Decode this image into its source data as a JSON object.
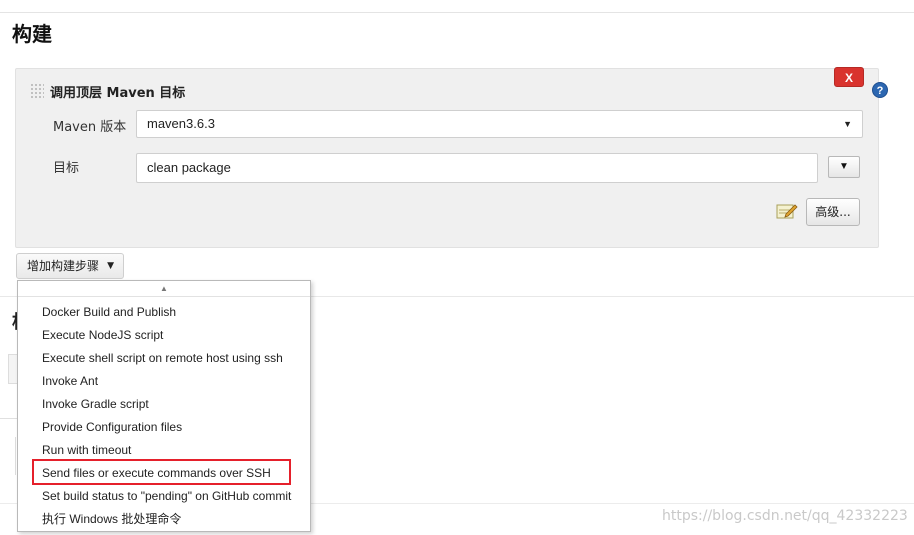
{
  "section": {
    "title": "构建"
  },
  "build_step": {
    "title": "调用顶层 Maven 目标",
    "delete_label": "X",
    "help_label": "?",
    "maven_version_label": "Maven 版本",
    "maven_version_value": "maven3.6.3",
    "goals_label": "目标",
    "goals_value": "clean package",
    "expand_label": "▼",
    "advanced_label": "高级..."
  },
  "add_step": {
    "label": "增加构建步骤",
    "caret": "▼"
  },
  "behind": {
    "title_fragment": "构"
  },
  "dropdown": {
    "scroll_up": "▲",
    "items": [
      {
        "label": "Docker Build and Publish"
      },
      {
        "label": "Execute NodeJS script"
      },
      {
        "label": "Execute shell script on remote host using ssh"
      },
      {
        "label": "Invoke Ant"
      },
      {
        "label": "Invoke Gradle script"
      },
      {
        "label": "Provide Configuration files"
      },
      {
        "label": "Run with timeout"
      },
      {
        "label": "Send files or execute commands over SSH",
        "highlighted": true
      },
      {
        "label": "Set build status to \"pending\" on GitHub commit"
      },
      {
        "label": "执行 Windows 批处理命令"
      }
    ]
  },
  "watermark": "https://blog.csdn.net/qq_42332223",
  "colors": {
    "delete_red": "#d9332e",
    "highlight_red": "#e5202b",
    "help_blue": "#2c67b1",
    "panel_bg": "#f0f0f0"
  }
}
